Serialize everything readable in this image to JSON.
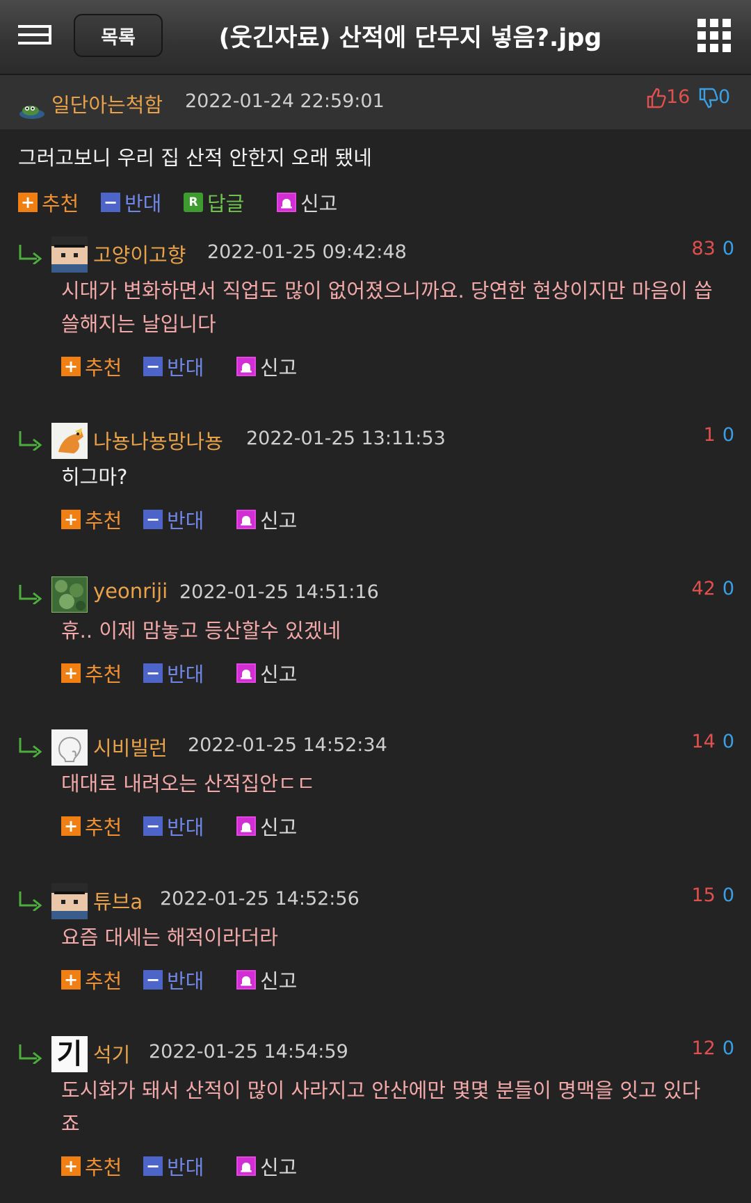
{
  "header": {
    "list_button": "목록",
    "title": "(웃긴자료) 산적에 단무지 넣음?.jpg",
    "menu_icon": "hamburger-icon",
    "apps_icon": "grid-icon"
  },
  "actions": {
    "recommend": "추천",
    "oppose": "반대",
    "reply": "답글",
    "report": "신고",
    "reply_badge": "R"
  },
  "post": {
    "author": "일단아는척함",
    "date": "2022-01-24 22:59:01",
    "up": "16",
    "down": "0",
    "body": "그러고보니 우리 집 산적 안한지 오래 됐네"
  },
  "comments": [
    {
      "author": "고양이고향",
      "date": "2022-01-25 09:42:48",
      "up": "83",
      "down": "0",
      "lines": [
        "시대가 변화하면서 직업도 많이 없어졌으니까요. 당연한 현상이지만 마음이 씁",
        "쓸해지는 날입니다"
      ]
    },
    {
      "author": "나뇽나뇽망나뇽",
      "date": "2022-01-25 13:11:53",
      "up": "1",
      "down": "0",
      "lines": [
        "히그마?"
      ]
    },
    {
      "author": "yeonriji",
      "date": "2022-01-25 14:51:16",
      "up": "42",
      "down": "0",
      "lines": [
        "휴.. 이제 맘놓고 등산할수 있겠네"
      ]
    },
    {
      "author": "시비빌런",
      "date": "2022-01-25 14:52:34",
      "up": "14",
      "down": "0",
      "lines": [
        "대대로 내려오는 산적집안ㄷㄷ"
      ]
    },
    {
      "author": "튜브a",
      "date": "2022-01-25 14:52:56",
      "up": "15",
      "down": "0",
      "lines": [
        "요즘 대세는 해적이라더라"
      ]
    },
    {
      "author": "석기",
      "date": "2022-01-25 14:54:59",
      "up": "12",
      "down": "0",
      "lines": [
        "도시화가 돼서 산적이 많이 사라지고 안산에만 몇몇 분들이 명맥을 잇고 있다",
        "죠"
      ]
    }
  ],
  "avatar_text": {
    "seokgi": "기"
  },
  "colors": {
    "background": "#232323",
    "author": "#e8a24a",
    "comment_text": "#f3a9a9",
    "upvote": "#e0504e",
    "downvote": "#3aa0e6",
    "recommend": "#f07f14",
    "oppose": "#4d65c9",
    "reply": "#3d9b2f",
    "report": "#d12fd3"
  }
}
